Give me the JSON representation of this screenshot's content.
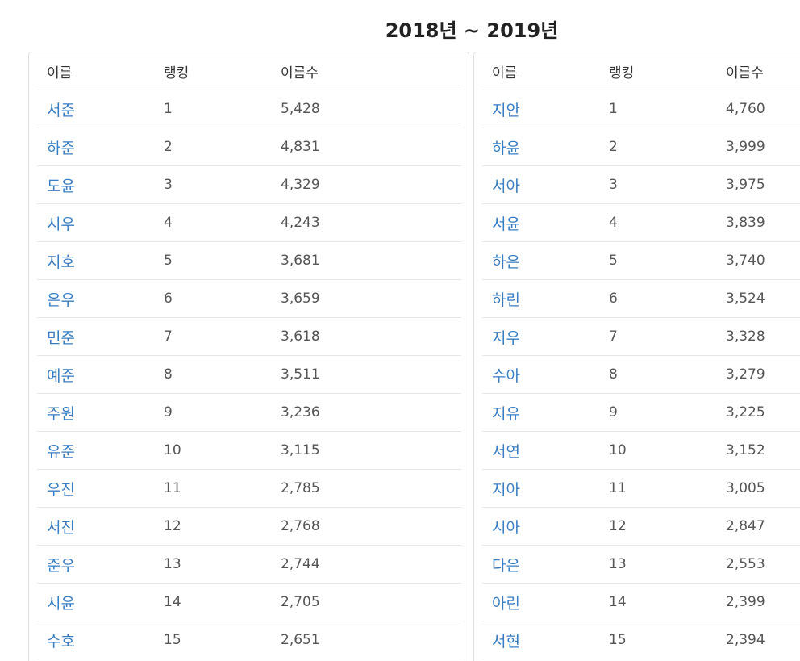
{
  "title": "2018년 ~ 2019년",
  "headers": {
    "name": "이름",
    "rank": "랭킹",
    "count": "이름수"
  },
  "boys": [
    {
      "name": "서준",
      "rank": "1",
      "count": "5,428"
    },
    {
      "name": "하준",
      "rank": "2",
      "count": "4,831"
    },
    {
      "name": "도윤",
      "rank": "3",
      "count": "4,329"
    },
    {
      "name": "시우",
      "rank": "4",
      "count": "4,243"
    },
    {
      "name": "지호",
      "rank": "5",
      "count": "3,681"
    },
    {
      "name": "은우",
      "rank": "6",
      "count": "3,659"
    },
    {
      "name": "민준",
      "rank": "7",
      "count": "3,618"
    },
    {
      "name": "예준",
      "rank": "8",
      "count": "3,511"
    },
    {
      "name": "주원",
      "rank": "9",
      "count": "3,236"
    },
    {
      "name": "유준",
      "rank": "10",
      "count": "3,115"
    },
    {
      "name": "우진",
      "rank": "11",
      "count": "2,785"
    },
    {
      "name": "서진",
      "rank": "12",
      "count": "2,768"
    },
    {
      "name": "준우",
      "rank": "13",
      "count": "2,744"
    },
    {
      "name": "시윤",
      "rank": "14",
      "count": "2,705"
    },
    {
      "name": "수호",
      "rank": "15",
      "count": "2,651"
    }
  ],
  "girls": [
    {
      "name": "지안",
      "rank": "1",
      "count": "4,760"
    },
    {
      "name": "하윤",
      "rank": "2",
      "count": "3,999"
    },
    {
      "name": "서아",
      "rank": "3",
      "count": "3,975"
    },
    {
      "name": "서윤",
      "rank": "4",
      "count": "3,839"
    },
    {
      "name": "하은",
      "rank": "5",
      "count": "3,740"
    },
    {
      "name": "하린",
      "rank": "6",
      "count": "3,524"
    },
    {
      "name": "지우",
      "rank": "7",
      "count": "3,328"
    },
    {
      "name": "수아",
      "rank": "8",
      "count": "3,279"
    },
    {
      "name": "지유",
      "rank": "9",
      "count": "3,225"
    },
    {
      "name": "서연",
      "rank": "10",
      "count": "3,152"
    },
    {
      "name": "지아",
      "rank": "11",
      "count": "3,005"
    },
    {
      "name": "시아",
      "rank": "12",
      "count": "2,847"
    },
    {
      "name": "다은",
      "rank": "13",
      "count": "2,553"
    },
    {
      "name": "아린",
      "rank": "14",
      "count": "2,399"
    },
    {
      "name": "서현",
      "rank": "15",
      "count": "2,394"
    }
  ],
  "colors": {
    "link": "#3a7ec2",
    "text": "#444444",
    "border": "#e6e6e6"
  }
}
